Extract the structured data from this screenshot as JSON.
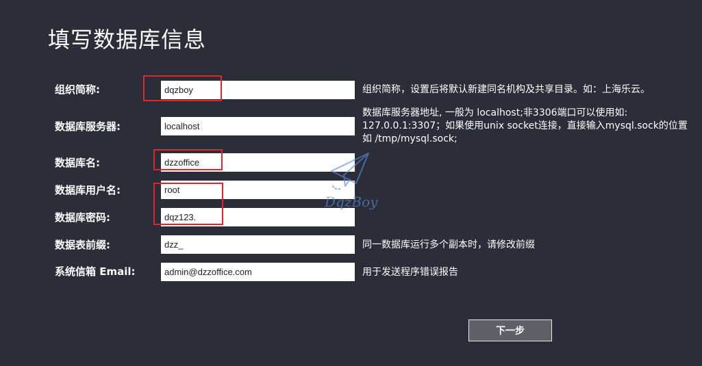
{
  "page": {
    "title": "填写数据库信息"
  },
  "form": {
    "fields": [
      {
        "label": "组织简称:",
        "value": "dqzboy",
        "hint": "组织简称，设置后将默认新建同名机构及共享目录。如：上海乐云。"
      },
      {
        "label": "数据库服务器:",
        "value": "localhost",
        "hint": "数据库服务器地址, 一般为 localhost;非3306端口可以使用如: 127.0.0.1:3307；如果使用unix socket连接，直接输入mysql.sock的位置如 /tmp/mysql.sock;"
      },
      {
        "label": "数据库名:",
        "value": "dzzoffice",
        "hint": ""
      },
      {
        "label": "数据库用户名:",
        "value": "root",
        "hint": ""
      },
      {
        "label": "数据库密码:",
        "value": "dqz123.",
        "hint": ""
      },
      {
        "label": "数据表前缀:",
        "value": "dzz_",
        "hint": "同一数据库运行多个副本时，请修改前缀"
      },
      {
        "label": "系统信箱 Email:",
        "value": "admin@dzzoffice.com",
        "hint": "用于发送程序错误报告"
      }
    ]
  },
  "watermark": {
    "text": "DqzBoy",
    "color": "#5b8bd6"
  },
  "actions": {
    "next_label": "下一步"
  },
  "colors": {
    "background": "#2b2d38",
    "highlight": "#e0262b",
    "button": "#5e6068"
  }
}
